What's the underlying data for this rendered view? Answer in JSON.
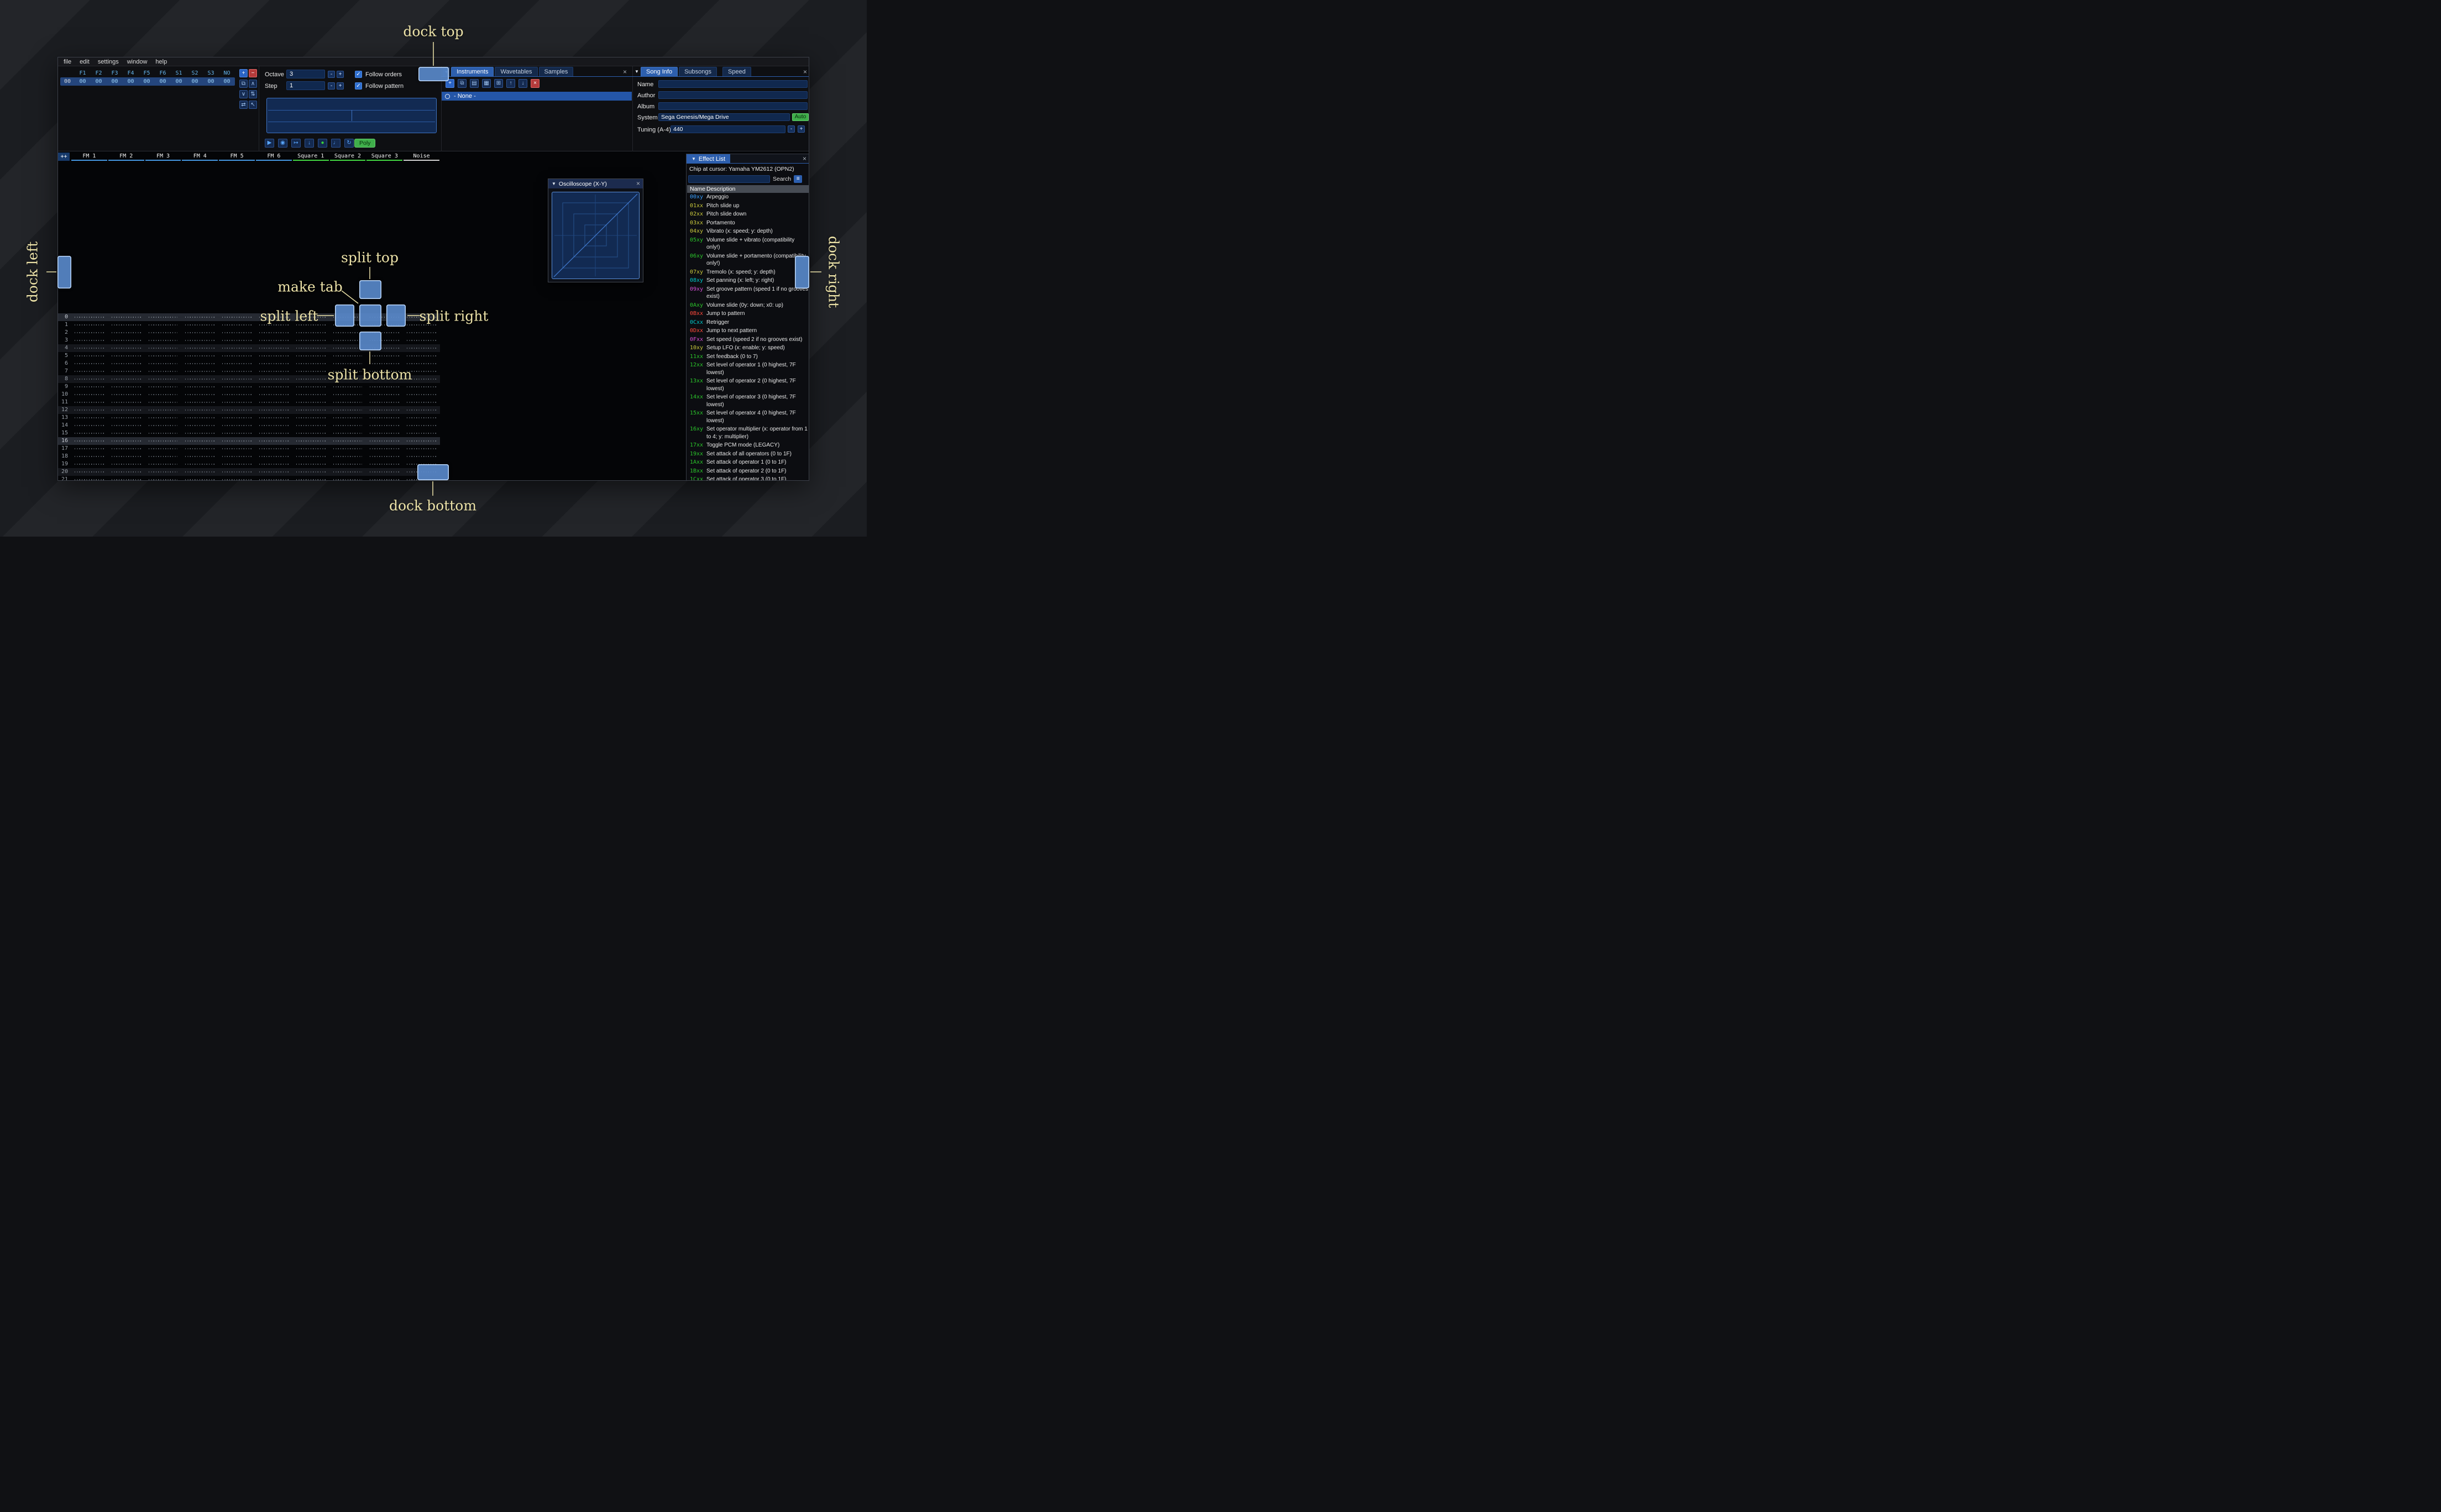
{
  "menu": {
    "items": [
      "file",
      "edit",
      "settings",
      "window",
      "help"
    ]
  },
  "orders": {
    "row_label": "00",
    "columns": [
      "F1",
      "F2",
      "F3",
      "F4",
      "F5",
      "F6",
      "S1",
      "S2",
      "S3",
      "NO"
    ],
    "values": [
      "00",
      "00",
      "00",
      "00",
      "00",
      "00",
      "00",
      "00",
      "00",
      "00"
    ],
    "toolbar": [
      {
        "name": "add-order",
        "glyph": "+",
        "style": "add"
      },
      {
        "name": "remove-order",
        "glyph": "−",
        "style": "del"
      },
      {
        "name": "duplicate-order",
        "glyph": "⧉",
        "style": ""
      },
      {
        "name": "order-up",
        "glyph": "∧",
        "style": ""
      },
      {
        "name": "order-down",
        "glyph": "∨",
        "style": ""
      },
      {
        "name": "duplicate-order-to-end",
        "glyph": "⇅",
        "style": ""
      },
      {
        "name": "change-all-orders",
        "glyph": "⇄",
        "style": ""
      },
      {
        "name": "order-edit-mode",
        "glyph": "↖",
        "style": ""
      }
    ]
  },
  "play_controls": {
    "octave_label": "Octave",
    "octave_value": "3",
    "step_label": "Step",
    "step_value": "1",
    "minus_label": "-",
    "plus_label": "+",
    "follow_orders_label": "Follow orders",
    "follow_pattern_label": "Follow pattern",
    "transport": [
      {
        "name": "play",
        "glyph": "▶",
        "color": "#5aa8ff"
      },
      {
        "name": "play-pattern",
        "glyph": "◉",
        "color": "#5aa8ff"
      },
      {
        "name": "step-one-row",
        "glyph": "↦",
        "color": "#5aa8ff"
      },
      {
        "name": "move-cursor-down",
        "glyph": "↓",
        "color": "#5aa8ff"
      },
      {
        "name": "record",
        "glyph": "●",
        "color": "#3ad13a"
      },
      {
        "name": "metronome",
        "glyph": "♩",
        "color": "#5aa8ff"
      },
      {
        "name": "repeat-pattern",
        "glyph": "↻",
        "color": "#5aa8ff"
      }
    ],
    "poly_label": "Poly"
  },
  "instruments_panel": {
    "tabs": [
      "Instruments",
      "Wavetables",
      "Samples"
    ],
    "active_tab": "Instruments",
    "toolbar": [
      {
        "name": "add-instrument",
        "glyph": "+",
        "style": "add"
      },
      {
        "name": "duplicate-instrument",
        "glyph": "⧉",
        "style": ""
      },
      {
        "name": "open-instrument",
        "glyph": "▤",
        "style": ""
      },
      {
        "name": "save-instrument",
        "glyph": "▦",
        "style": ""
      },
      {
        "name": "instrument-folder-view",
        "glyph": "⊞",
        "style": ""
      },
      {
        "name": "instrument-up",
        "glyph": "↑",
        "style": ""
      },
      {
        "name": "instrument-down",
        "glyph": "↓",
        "style": ""
      },
      {
        "name": "delete-instrument",
        "glyph": "×",
        "style": "del"
      }
    ],
    "selected_item": "- None -"
  },
  "song_info": {
    "tabs": [
      "Song Info",
      "Subsongs",
      "Speed"
    ],
    "active_tab": "Song Info",
    "name_label": "Name",
    "name_value": "",
    "author_label": "Author",
    "author_value": "",
    "album_label": "Album",
    "album_value": "",
    "system_label": "System",
    "system_value": "Sega Genesis/Mega Drive",
    "auto_label": "Auto",
    "tuning_label": "Tuning (A-4)",
    "tuning_value": "440"
  },
  "pattern": {
    "expand_label": "++",
    "channels": [
      {
        "name": "FM 1",
        "color": "#4596e0"
      },
      {
        "name": "FM 2",
        "color": "#4596e0"
      },
      {
        "name": "FM 3",
        "color": "#4596e0"
      },
      {
        "name": "FM 4",
        "color": "#4596e0"
      },
      {
        "name": "FM 5",
        "color": "#4596e0"
      },
      {
        "name": "FM 6",
        "color": "#4596e0"
      },
      {
        "name": "Square 1",
        "color": "#42d742"
      },
      {
        "name": "Square 2",
        "color": "#42d742"
      },
      {
        "name": "Square 3",
        "color": "#42d742"
      },
      {
        "name": "Noise",
        "color": "#d0d0d0"
      }
    ],
    "rows": [
      "0",
      "1",
      "2",
      "3",
      "4",
      "5",
      "6",
      "7",
      "8",
      "9",
      "10",
      "11",
      "12",
      "13",
      "14",
      "15",
      "16",
      "17",
      "18",
      "19",
      "20",
      "21"
    ],
    "highlight_major": [
      0,
      16
    ],
    "highlight_minor": [
      4,
      8,
      12,
      20
    ]
  },
  "oscilloscope": {
    "title": "Oscilloscope (X-Y)"
  },
  "effect_list": {
    "title": "Effect List",
    "chip_line": "Chip at cursor: Yamaha YM2612 (OPN2)",
    "search_label": "Search",
    "name_header": "Name",
    "description_header": "Description",
    "effects": [
      {
        "code": "00xy",
        "color": "#3aa0ff",
        "desc": "Arpeggio"
      },
      {
        "code": "01xx",
        "color": "#c9c93c",
        "desc": "Pitch slide up"
      },
      {
        "code": "02xx",
        "color": "#c9c93c",
        "desc": "Pitch slide down"
      },
      {
        "code": "03xx",
        "color": "#c9c93c",
        "desc": "Portamento"
      },
      {
        "code": "04xy",
        "color": "#c9c93c",
        "desc": "Vibrato (x: speed; y: depth)"
      },
      {
        "code": "05xy",
        "color": "#2bc62b",
        "desc": "Volume slide + vibrato (compatibility only!)"
      },
      {
        "code": "06xy",
        "color": "#2bc62b",
        "desc": "Volume slide + portamento (compatibility only!)"
      },
      {
        "code": "07xy",
        "color": "#c9c93c",
        "desc": "Tremolo (x: speed; y: depth)"
      },
      {
        "code": "08xy",
        "color": "#00c8c8",
        "desc": "Set panning (x: left; y: right)"
      },
      {
        "code": "09xy",
        "color": "#d44fd4",
        "desc": "Set groove pattern (speed 1 if no grooves exist)"
      },
      {
        "code": "0Axy",
        "color": "#2bc62b",
        "desc": "Volume slide (0y: down; x0: up)"
      },
      {
        "code": "0Bxx",
        "color": "#ff4a3c",
        "desc": "Jump to pattern"
      },
      {
        "code": "0Cxx",
        "color": "#00c8c8",
        "desc": "Retrigger"
      },
      {
        "code": "0Dxx",
        "color": "#ff4a3c",
        "desc": "Jump to next pattern"
      },
      {
        "code": "0Fxx",
        "color": "#d44fd4",
        "desc": "Set speed (speed 2 if no grooves exist)"
      },
      {
        "code": "10xy",
        "color": "#c9c93c",
        "desc": "Setup LFO (x: enable; y: speed)"
      },
      {
        "code": "11xx",
        "color": "#2bc62b",
        "desc": "Set feedback (0 to 7)"
      },
      {
        "code": "12xx",
        "color": "#2bc62b",
        "desc": "Set level of operator 1 (0 highest, 7F lowest)"
      },
      {
        "code": "13xx",
        "color": "#2bc62b",
        "desc": "Set level of operator 2 (0 highest, 7F lowest)"
      },
      {
        "code": "14xx",
        "color": "#2bc62b",
        "desc": "Set level of operator 3 (0 highest, 7F lowest)"
      },
      {
        "code": "15xx",
        "color": "#2bc62b",
        "desc": "Set level of operator 4 (0 highest, 7F lowest)"
      },
      {
        "code": "16xy",
        "color": "#2bc62b",
        "desc": "Set operator multiplier (x: operator from 1 to 4; y: multiplier)"
      },
      {
        "code": "17xx",
        "color": "#2bc62b",
        "desc": "Toggle PCM mode (LEGACY)"
      },
      {
        "code": "19xx",
        "color": "#2bc62b",
        "desc": "Set attack of all operators (0 to 1F)"
      },
      {
        "code": "1Axx",
        "color": "#2bc62b",
        "desc": "Set attack of operator 1 (0 to 1F)"
      },
      {
        "code": "1Bxx",
        "color": "#2bc62b",
        "desc": "Set attack of operator 2 (0 to 1F)"
      },
      {
        "code": "1Cxx",
        "color": "#2bc62b",
        "desc": "Set attack of operator 3 (0 to 1F)"
      }
    ]
  },
  "annotations": {
    "dock_top": "dock top",
    "dock_left": "dock left",
    "dock_right": "dock right",
    "dock_bottom": "dock bottom",
    "split_top": "split top",
    "split_left": "split left",
    "split_right": "split right",
    "split_bottom": "split bottom",
    "make_tab": "make tab"
  },
  "icons": {
    "collapse": "▼",
    "dropdown": "▾",
    "close": "×",
    "hamburger": "≡",
    "check": "✓"
  }
}
